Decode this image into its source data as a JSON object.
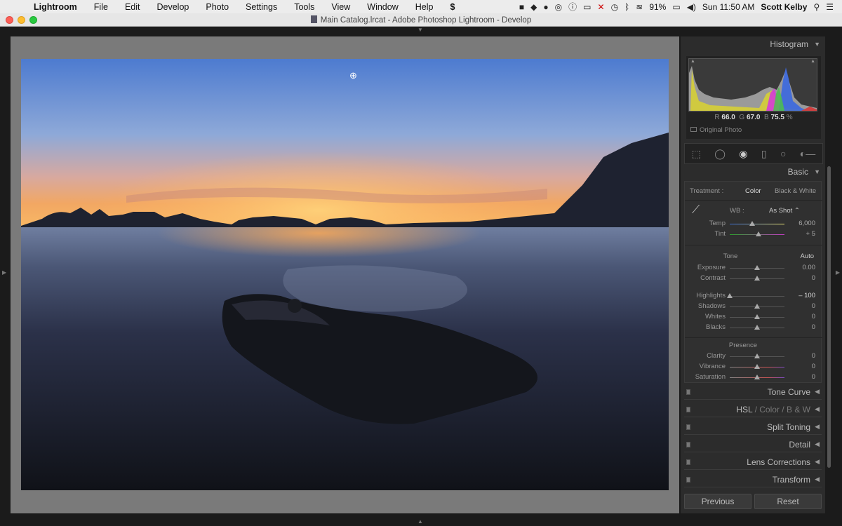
{
  "menubar": {
    "app": "Lightroom",
    "items": [
      "File",
      "Edit",
      "Develop",
      "Photo",
      "Settings",
      "Tools",
      "View",
      "Window",
      "Help"
    ],
    "battery": "91%",
    "clock": "Sun 11:50 AM",
    "user": "Scott Kelby"
  },
  "window": {
    "title": "Main Catalog.lrcat - Adobe Photoshop Lightroom - Develop"
  },
  "histogram": {
    "header": "Histogram",
    "r_label": "R",
    "r_value": "66.0",
    "g_label": "G",
    "g_value": "67.0",
    "b_label": "B",
    "b_value": "75.5",
    "unit": "%",
    "original_photo": "Original Photo"
  },
  "basic": {
    "header": "Basic",
    "treatment_label": "Treatment :",
    "treatment_color": "Color",
    "treatment_bw": "Black & White",
    "wb_label": "WB :",
    "wb_value": "As Shot",
    "temp": {
      "label": "Temp",
      "value": "6,000",
      "position": 0.41
    },
    "tint": {
      "label": "Tint",
      "value": "+ 5",
      "position": 0.52
    },
    "tone_title": "Tone",
    "auto": "Auto",
    "exposure": {
      "label": "Exposure",
      "value": "0.00",
      "position": 0.5
    },
    "contrast": {
      "label": "Contrast",
      "value": "0",
      "position": 0.5
    },
    "highlights": {
      "label": "Highlights",
      "value": "– 100",
      "position": 0.0
    },
    "shadows": {
      "label": "Shadows",
      "value": "0",
      "position": 0.5
    },
    "whites": {
      "label": "Whites",
      "value": "0",
      "position": 0.5
    },
    "blacks": {
      "label": "Blacks",
      "value": "0",
      "position": 0.5
    },
    "presence_title": "Presence",
    "clarity": {
      "label": "Clarity",
      "value": "0",
      "position": 0.5
    },
    "vibrance": {
      "label": "Vibrance",
      "value": "0",
      "position": 0.5
    },
    "saturation": {
      "label": "Saturation",
      "value": "0",
      "position": 0.5
    }
  },
  "panels": {
    "tone_curve": "Tone Curve",
    "hsl": "HSL",
    "hsl_sep1": "/",
    "hsl_color": "Color",
    "hsl_sep2": "/",
    "hsl_bw": "B & W",
    "split_toning": "Split Toning",
    "detail": "Detail",
    "lens_corrections": "Lens Corrections",
    "transform": "Transform"
  },
  "buttons": {
    "previous": "Previous",
    "reset": "Reset"
  }
}
